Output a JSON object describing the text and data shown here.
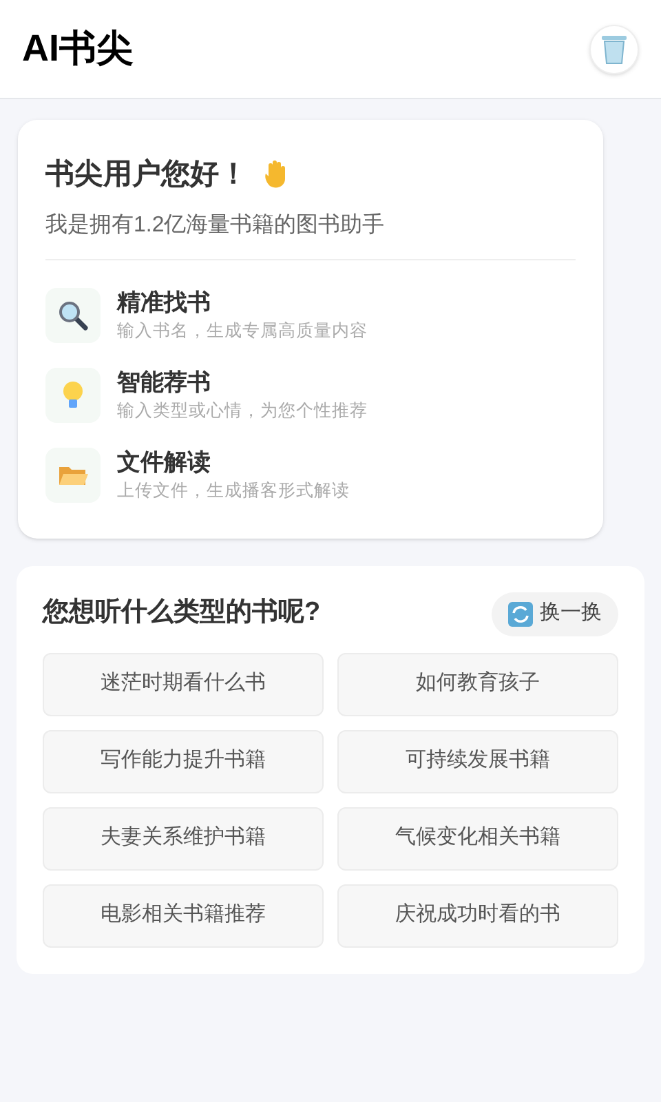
{
  "app_bar": {
    "title": "AI书尖"
  },
  "greeting": {
    "title": "书尖用户您好！",
    "subtitle": "我是拥有1.2亿海量书籍的图书助手",
    "features": [
      {
        "title": "精准找书",
        "description": "输入书名，生成专属高质量内容"
      },
      {
        "title": "智能荐书",
        "description": "输入类型或心情，为您个性推荐"
      },
      {
        "title": "文件解读",
        "description": "上传文件，生成播客形式解读"
      }
    ]
  },
  "topics": {
    "title": "您想听什么类型的书呢?",
    "refresh_button": "换一换",
    "chips": [
      "迷茫时期看什么书",
      "如何教育孩子",
      "写作能力提升书籍",
      "可持续发展书籍",
      "夫妻关系维护书籍",
      "气候变化相关书籍",
      "电影相关书籍推荐",
      "庆祝成功时看的书"
    ]
  }
}
